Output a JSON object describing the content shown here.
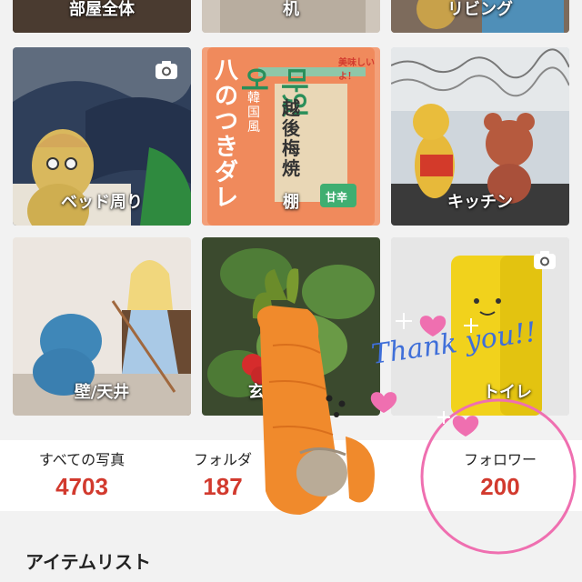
{
  "folders": [
    {
      "label": "部屋全体"
    },
    {
      "label": "机"
    },
    {
      "label": "リビング"
    },
    {
      "label": "ベッド周り"
    },
    {
      "label": "棚"
    },
    {
      "label": "キッチン"
    },
    {
      "label": "壁/天井"
    },
    {
      "label": "玄"
    },
    {
      "label": "トイレ"
    }
  ],
  "package_text": {
    "brand": "八のつきダレ",
    "korean_title": "마있어",
    "sticker": "越後梅焼",
    "sweet_tag": "甘辛",
    "side_tag": "韓国風",
    "top_badge": "美味しいよ！"
  },
  "stats": [
    {
      "label": "すべての写真",
      "value": "4703"
    },
    {
      "label": "フォルダ",
      "value": "187"
    },
    {
      "label": "フォロワー",
      "value": "200"
    }
  ],
  "item_list_title": "アイテムリスト",
  "handwritten_text": "Thank you!!",
  "colors": {
    "accent_red": "#d23a2e",
    "circle_pink": "#ef6fb0",
    "handwriting_blue": "#3f6fd9"
  },
  "icons": [
    "camera-icon",
    "heart-icon",
    "sparkle-icon"
  ]
}
